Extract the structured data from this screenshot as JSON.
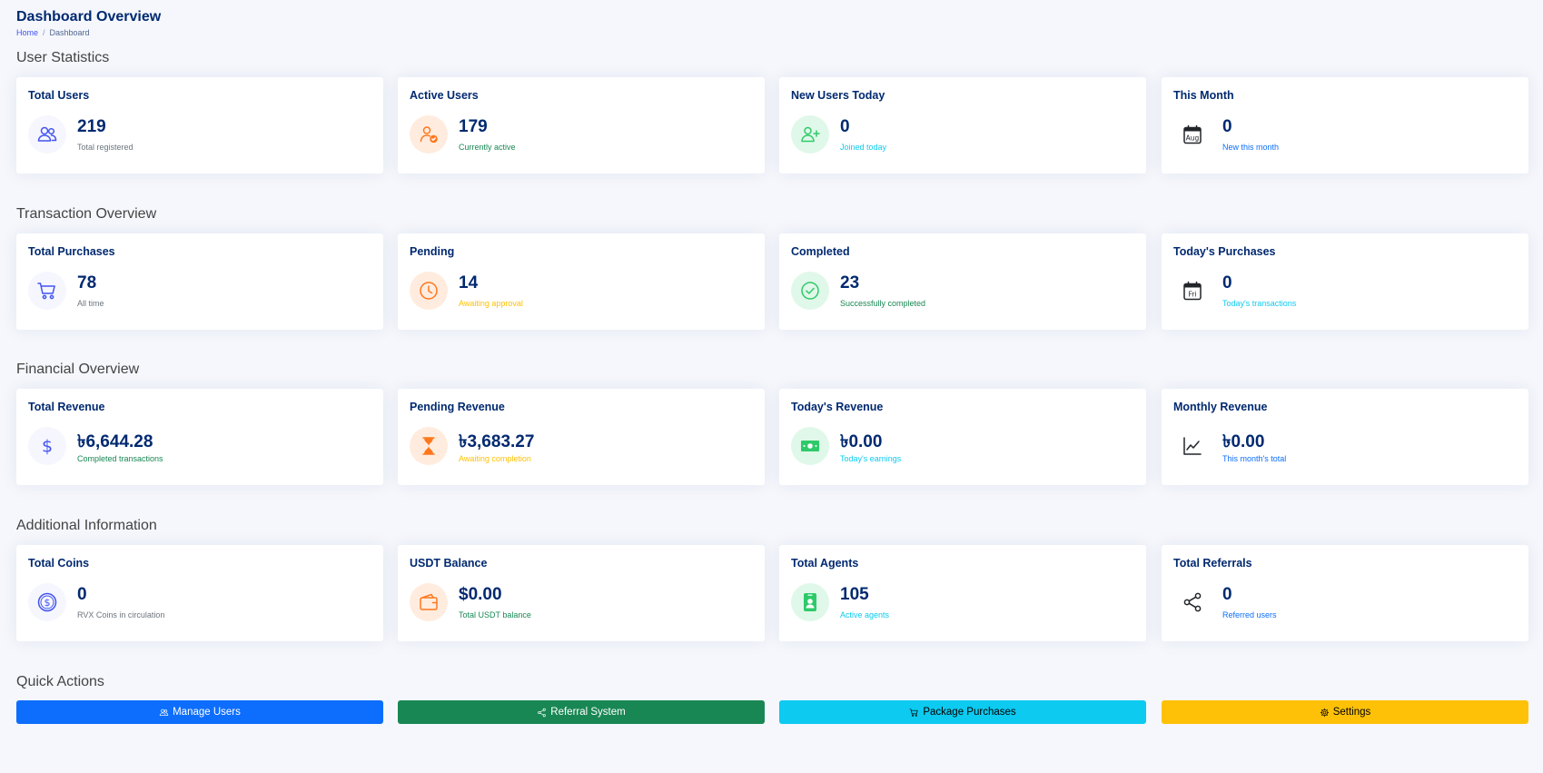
{
  "header": {
    "title": "Dashboard Overview",
    "breadcrumb": {
      "home": "Home",
      "separator": "/",
      "current": "Dashboard"
    }
  },
  "colors": {
    "accent": "#4154f1",
    "navy": "#012970",
    "orange": "#ff771d",
    "green": "#2eca6a",
    "cyan": "#0dcaf0",
    "yellow": "#ffc107",
    "dark_green": "#198754",
    "muted": "#6c757d"
  },
  "sections": [
    {
      "title": "User Statistics",
      "cards": [
        {
          "title": "Total Users",
          "value": "219",
          "sub": "Total registered",
          "icon": "users-icon",
          "color": "#4154f1",
          "sub_color": "#6c757d"
        },
        {
          "title": "Active Users",
          "value": "179",
          "sub": "Currently active",
          "icon": "user-check-icon",
          "color": "#ff771d",
          "sub_color": "#198754"
        },
        {
          "title": "New Users Today",
          "value": "0",
          "sub": "Joined today",
          "icon": "user-plus-icon",
          "color": "#2eca6a",
          "sub_color": "#0dcaf0"
        },
        {
          "title": "This Month",
          "value": "0",
          "sub": "New this month",
          "icon": "calendar-icon",
          "icon_text": "Aug",
          "color": "#212529",
          "sub_color": "#0d6efd"
        }
      ]
    },
    {
      "title": "Transaction Overview",
      "cards": [
        {
          "title": "Total Purchases",
          "value": "78",
          "sub": "All time",
          "icon": "cart-icon",
          "color": "#4154f1",
          "sub_color": "#6c757d"
        },
        {
          "title": "Pending",
          "value": "14",
          "sub": "Awaiting approval",
          "icon": "clock-icon",
          "color": "#ff771d",
          "sub_color": "#ffc107"
        },
        {
          "title": "Completed",
          "value": "23",
          "sub": "Successfully completed",
          "icon": "check-circle-icon",
          "color": "#2eca6a",
          "sub_color": "#198754"
        },
        {
          "title": "Today's Purchases",
          "value": "0",
          "sub": "Today's transactions",
          "icon": "calendar-icon",
          "icon_text": "Fri",
          "color": "#212529",
          "sub_color": "#0dcaf0"
        }
      ]
    },
    {
      "title": "Financial Overview",
      "cards": [
        {
          "title": "Total Revenue",
          "value": "৳6,644.28",
          "sub": "Completed transactions",
          "icon": "dollar-icon",
          "color": "#4154f1",
          "sub_color": "#198754"
        },
        {
          "title": "Pending Revenue",
          "value": "৳3,683.27",
          "sub": "Awaiting completion",
          "icon": "hourglass-icon",
          "color": "#ff771d",
          "sub_color": "#ffc107"
        },
        {
          "title": "Today's Revenue",
          "value": "৳0.00",
          "sub": "Today's earnings",
          "icon": "cash-icon",
          "color": "#2eca6a",
          "sub_color": "#0dcaf0"
        },
        {
          "title": "Monthly Revenue",
          "value": "৳0.00",
          "sub": "This month's total",
          "icon": "graph-icon",
          "color": "#212529",
          "sub_color": "#0d6efd"
        }
      ]
    },
    {
      "title": "Additional Information",
      "cards": [
        {
          "title": "Total Coins",
          "value": "0",
          "sub": "RVX Coins in circulation",
          "icon": "coin-icon",
          "color": "#4154f1",
          "sub_color": "#6c757d"
        },
        {
          "title": "USDT Balance",
          "value": "$0.00",
          "sub": "Total USDT balance",
          "icon": "wallet-icon",
          "color": "#ff771d",
          "sub_color": "#198754"
        },
        {
          "title": "Total Agents",
          "value": "105",
          "sub": "Active agents",
          "icon": "badge-icon",
          "color": "#2eca6a",
          "sub_color": "#0dcaf0"
        },
        {
          "title": "Total Referrals",
          "value": "0",
          "sub": "Referred users",
          "icon": "share-icon",
          "color": "#212529",
          "sub_color": "#0d6efd"
        }
      ]
    }
  ],
  "quick_actions": {
    "title": "Quick Actions",
    "buttons": [
      {
        "label": "Manage Users",
        "icon": "users-icon",
        "bg": "#0d6efd",
        "fg": "#ffffff"
      },
      {
        "label": "Referral System",
        "icon": "share-icon",
        "bg": "#198754",
        "fg": "#ffffff"
      },
      {
        "label": "Package Purchases",
        "icon": "cart-icon",
        "bg": "#0dcaf0",
        "fg": "#000000"
      },
      {
        "label": "Settings",
        "icon": "gear-icon",
        "bg": "#ffc107",
        "fg": "#000000"
      }
    ]
  }
}
